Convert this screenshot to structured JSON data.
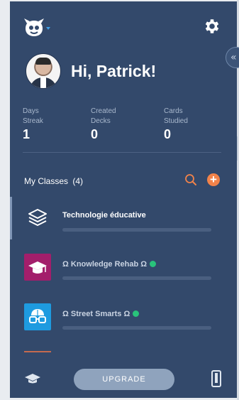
{
  "header": {
    "logo": "monster-logo-icon",
    "settings": "gear-icon"
  },
  "collapse_tab": {
    "glyph": "«"
  },
  "user": {
    "greeting": "Hi, Patrick!",
    "avatar": "profile-photo"
  },
  "stats": [
    {
      "label": "Days\nStreak",
      "value": "1"
    },
    {
      "label": "Created\nDecks",
      "value": "0"
    },
    {
      "label": "Cards\nStudied",
      "value": "0"
    }
  ],
  "classes": {
    "title": "My Classes",
    "count": "(4)",
    "search_icon": "search-icon",
    "add_icon": "plus-icon",
    "add_glyph": "+",
    "items": [
      {
        "name": "Technologie éducative",
        "icon": "layers-icon",
        "icon_bg": "#33496b",
        "verified": false,
        "progress": 0
      },
      {
        "name": "Ω Knowledge Rehab Ω",
        "icon": "graduation-cap-icon",
        "icon_bg": "#a31e6b",
        "verified": true,
        "progress": 0
      },
      {
        "name": "Ω Street Smarts Ω",
        "icon": "brain-glasses-icon",
        "icon_bg": "#1e9be0",
        "verified": true,
        "progress": 0
      }
    ]
  },
  "footer": {
    "upgrade_label": "UPGRADE",
    "left_icon": "graduation-cap-icon",
    "right_icon": "phone-icon"
  },
  "colors": {
    "panel": "#33496b",
    "accent_orange": "#f2834a",
    "verified_green": "#29c37b"
  }
}
